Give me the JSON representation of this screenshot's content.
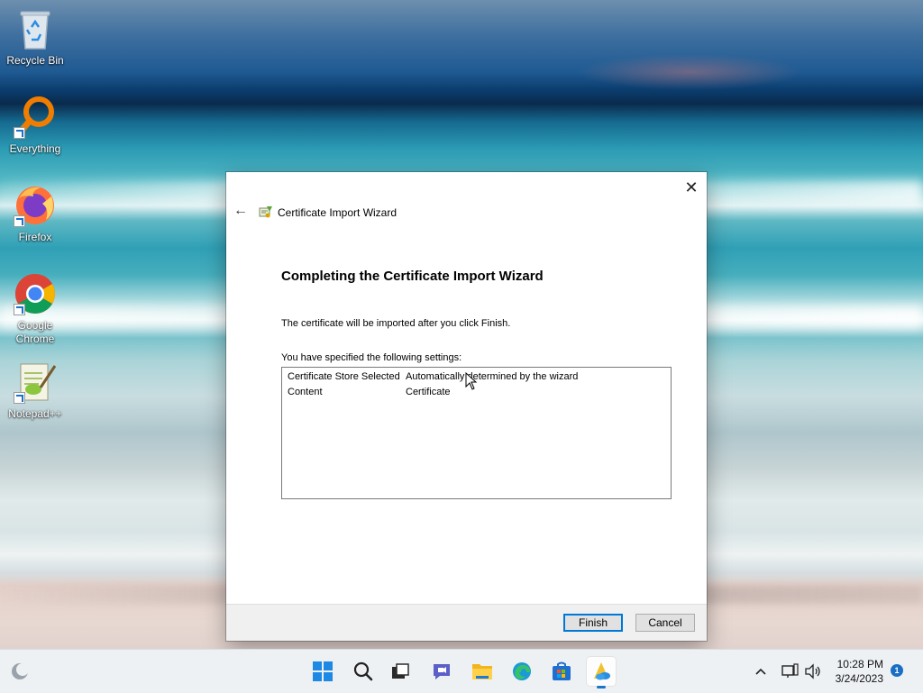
{
  "desktop": {
    "icons": [
      {
        "label": "Recycle Bin",
        "icon": "recycle-bin-icon"
      },
      {
        "label": "Everything",
        "icon": "everything-search-icon"
      },
      {
        "label": "Firefox",
        "icon": "firefox-icon"
      },
      {
        "label": "Google Chrome",
        "icon": "chrome-icon"
      },
      {
        "label": "Notepad++",
        "icon": "notepadpp-icon"
      }
    ]
  },
  "dialog": {
    "window_title": "Certificate Import Wizard",
    "heading": "Completing the Certificate Import Wizard",
    "description": "The certificate will be imported after you click Finish.",
    "settings_label": "You have specified the following settings:",
    "settings": [
      {
        "key": "Certificate Store Selected",
        "value": "Automatically determined by the wizard"
      },
      {
        "key": "Content",
        "value": "Certificate"
      }
    ],
    "buttons": {
      "finish": "Finish",
      "cancel": "Cancel"
    },
    "close_glyph": "✕",
    "back_glyph": "←"
  },
  "taskbar": {
    "apps": [
      "start-icon",
      "search-icon",
      "task-view-icon",
      "chat-icon",
      "file-explorer-icon",
      "edge-icon",
      "store-icon",
      "certificate-manager-icon"
    ],
    "tray": {
      "time": "10:28 PM",
      "date": "3/24/2023",
      "notification_count": "1"
    }
  }
}
